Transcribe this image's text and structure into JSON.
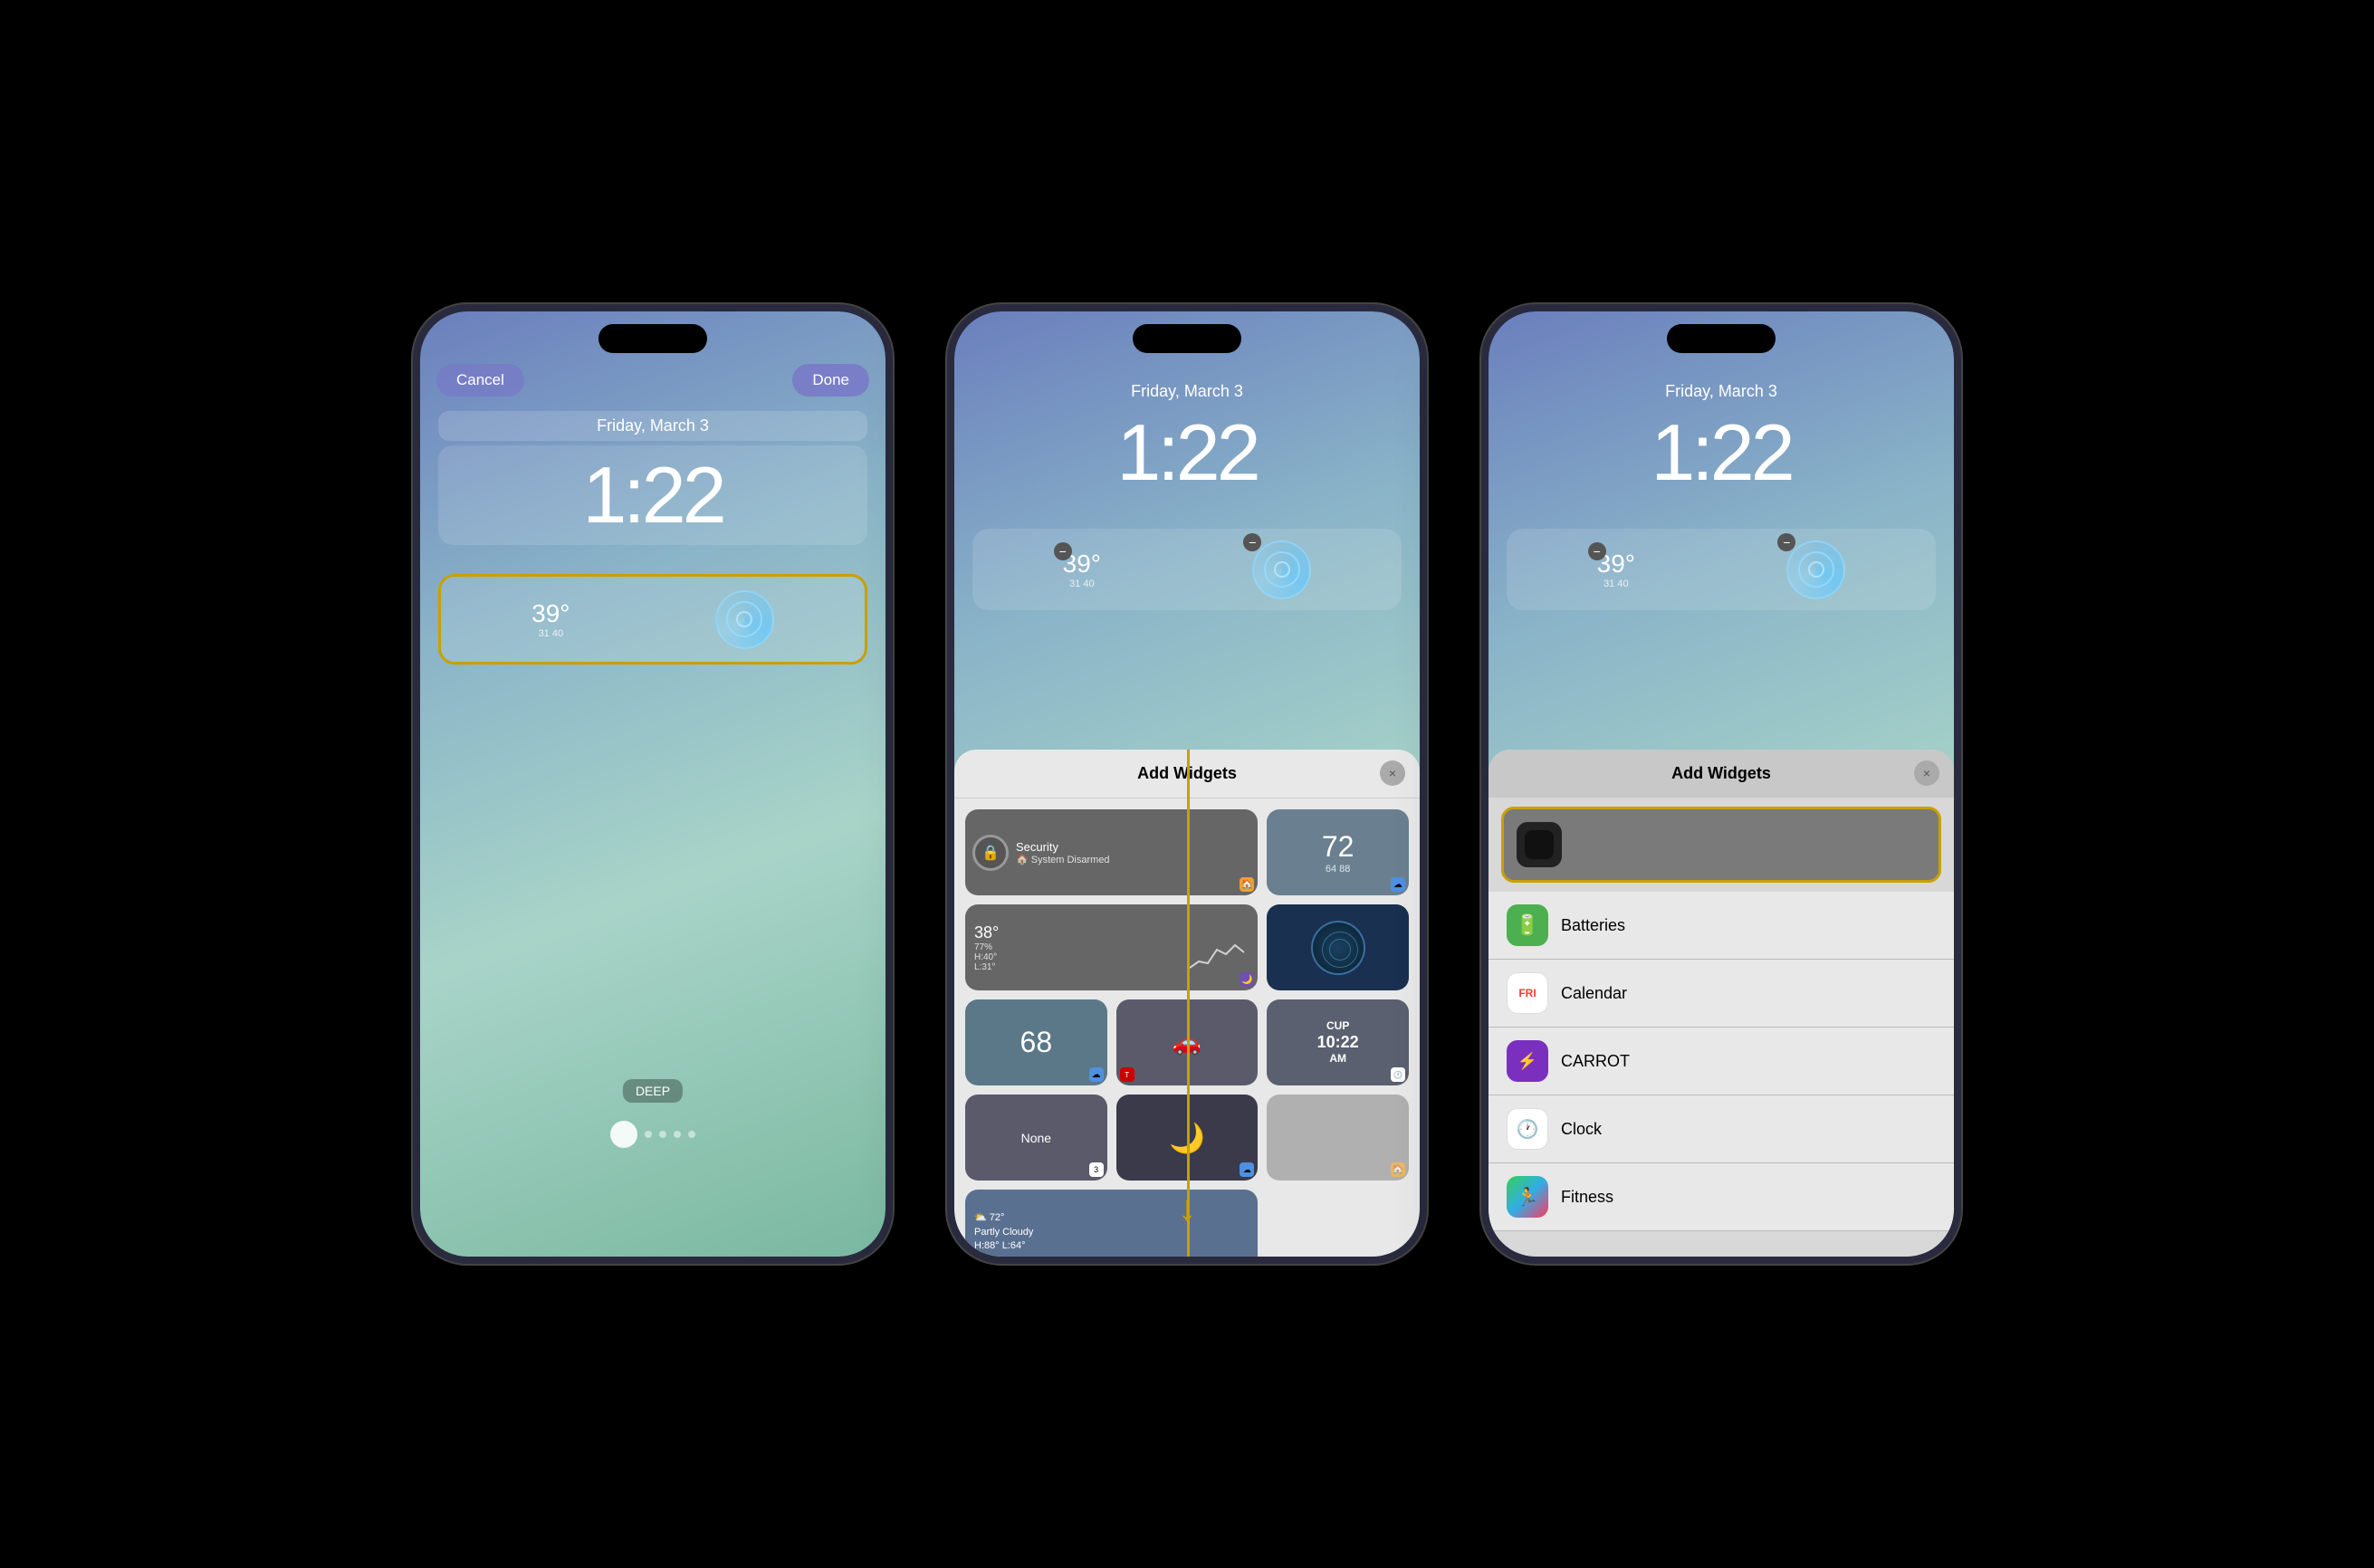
{
  "phone1": {
    "cancel_label": "Cancel",
    "done_label": "Done",
    "date": "Friday, March 3",
    "time": "1:22",
    "widget_temp": "39°",
    "widget_temp_range": "31   40",
    "deep_label": "DEEP",
    "page_dots": [
      false,
      false,
      true,
      false,
      false
    ]
  },
  "phone2": {
    "date": "Friday, March 3",
    "time": "1:22",
    "sheet_title": "Add Widgets",
    "close_label": "×",
    "widgets": [
      {
        "type": "security",
        "icon": "🔒",
        "title": "Security",
        "subtitle": "System Disarmed"
      },
      {
        "type": "number",
        "value": "72",
        "range": "64  88"
      },
      {
        "type": "weather_wide",
        "temp": "38°",
        "humidity": "77%",
        "high": "H:40°",
        "low": "L:31°"
      },
      {
        "type": "radar"
      },
      {
        "type": "number2",
        "value": "68"
      },
      {
        "type": "tesla"
      },
      {
        "type": "cup",
        "line1": "CUP",
        "line2": "10:22",
        "line3": "AM"
      },
      {
        "type": "none",
        "label": "None"
      },
      {
        "type": "moon"
      },
      {
        "type": "weather_bottom",
        "icon": "⛅",
        "temp": "72°",
        "desc": "Partly Cloudy",
        "high": "H:88° L:64°"
      }
    ],
    "arrow": "↓"
  },
  "phone3": {
    "date": "Friday, March 3",
    "time": "1:22",
    "sheet_title": "Add Widgets",
    "close_label": "×",
    "selected_item_label": "",
    "list_items": [
      {
        "icon": "🔋",
        "label": "Batteries",
        "bg": "#4CAF50"
      },
      {
        "icon": "3",
        "label": "Calendar",
        "bg": "#FF3B30",
        "is_calendar": true
      },
      {
        "icon": "💜",
        "label": "CARROT",
        "bg": "#7B2FBE",
        "is_carrot": true
      },
      {
        "icon": "🕐",
        "label": "Clock",
        "bg": "#fff",
        "is_clock": true
      },
      {
        "icon": "🏃",
        "label": "Fitness",
        "bg": "#FF2D55",
        "is_fitness": true
      }
    ]
  }
}
